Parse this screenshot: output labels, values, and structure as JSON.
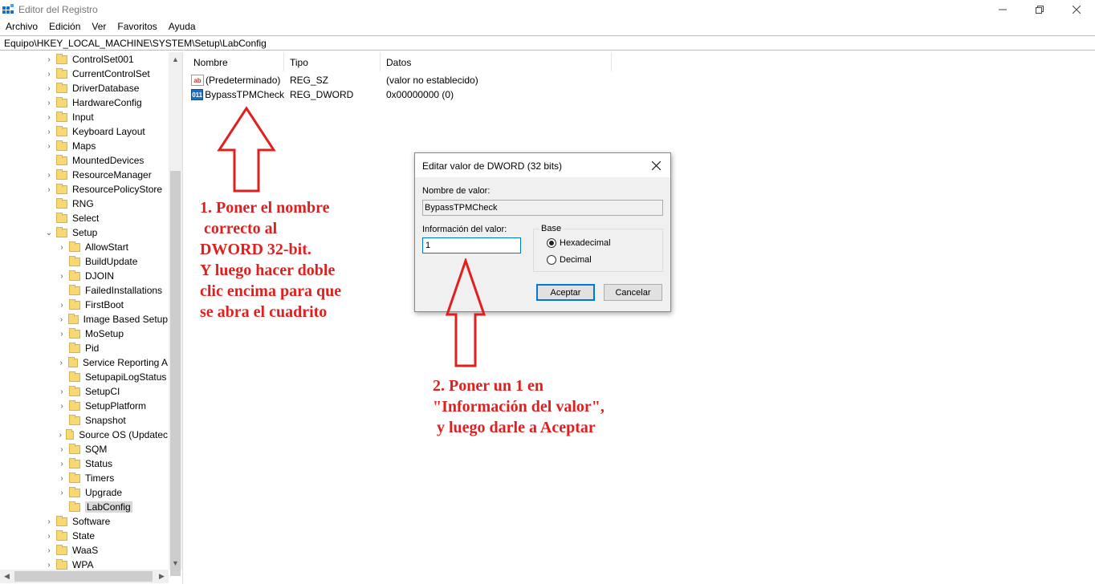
{
  "window": {
    "title": "Editor del Registro"
  },
  "menu": [
    "Archivo",
    "Edición",
    "Ver",
    "Favoritos",
    "Ayuda"
  ],
  "address": "Equipo\\HKEY_LOCAL_MACHINE\\SYSTEM\\Setup\\LabConfig",
  "tree": {
    "items": [
      {
        "label": "ControlSet001",
        "level": 0,
        "chevron": "›"
      },
      {
        "label": "CurrentControlSet",
        "level": 0,
        "chevron": "›"
      },
      {
        "label": "DriverDatabase",
        "level": 0,
        "chevron": "›"
      },
      {
        "label": "HardwareConfig",
        "level": 0,
        "chevron": "›"
      },
      {
        "label": "Input",
        "level": 0,
        "chevron": "›"
      },
      {
        "label": "Keyboard Layout",
        "level": 0,
        "chevron": "›"
      },
      {
        "label": "Maps",
        "level": 0,
        "chevron": "›"
      },
      {
        "label": "MountedDevices",
        "level": 0,
        "chevron": ""
      },
      {
        "label": "ResourceManager",
        "level": 0,
        "chevron": "›"
      },
      {
        "label": "ResourcePolicyStore",
        "level": 0,
        "chevron": "›"
      },
      {
        "label": "RNG",
        "level": 0,
        "chevron": ""
      },
      {
        "label": "Select",
        "level": 0,
        "chevron": ""
      },
      {
        "label": "Setup",
        "level": 0,
        "chevron": "⌄"
      },
      {
        "label": "AllowStart",
        "level": 1,
        "chevron": "›"
      },
      {
        "label": "BuildUpdate",
        "level": 1,
        "chevron": ""
      },
      {
        "label": "DJOIN",
        "level": 1,
        "chevron": "›"
      },
      {
        "label": "FailedInstallations",
        "level": 1,
        "chevron": ""
      },
      {
        "label": "FirstBoot",
        "level": 1,
        "chevron": "›"
      },
      {
        "label": "Image Based Setup",
        "level": 1,
        "chevron": "›"
      },
      {
        "label": "MoSetup",
        "level": 1,
        "chevron": "›"
      },
      {
        "label": "Pid",
        "level": 1,
        "chevron": ""
      },
      {
        "label": "Service Reporting A",
        "level": 1,
        "chevron": "›"
      },
      {
        "label": "SetupapiLogStatus",
        "level": 1,
        "chevron": ""
      },
      {
        "label": "SetupCI",
        "level": 1,
        "chevron": "›"
      },
      {
        "label": "SetupPlatform",
        "level": 1,
        "chevron": "›"
      },
      {
        "label": "Snapshot",
        "level": 1,
        "chevron": ""
      },
      {
        "label": "Source OS (Updatec",
        "level": 1,
        "chevron": "›"
      },
      {
        "label": "SQM",
        "level": 1,
        "chevron": "›"
      },
      {
        "label": "Status",
        "level": 1,
        "chevron": "›"
      },
      {
        "label": "Timers",
        "level": 1,
        "chevron": "›"
      },
      {
        "label": "Upgrade",
        "level": 1,
        "chevron": "›"
      },
      {
        "label": "LabConfig",
        "level": 1,
        "chevron": "",
        "selected": true
      },
      {
        "label": "Software",
        "level": 0,
        "chevron": "›"
      },
      {
        "label": "State",
        "level": 0,
        "chevron": "›"
      },
      {
        "label": "WaaS",
        "level": 0,
        "chevron": "›"
      },
      {
        "label": "WPA",
        "level": 0,
        "chevron": "›"
      }
    ]
  },
  "list": {
    "columns": [
      "Nombre",
      "Tipo",
      "Datos"
    ],
    "rows": [
      {
        "icon": "ab",
        "icon_name": "string-value-icon",
        "name": "(Predeterminado)",
        "type": "REG_SZ",
        "data": "(valor no establecido)"
      },
      {
        "icon": "011",
        "icon_name": "dword-value-icon",
        "name": "BypassTPMCheck",
        "type": "REG_DWORD",
        "data": "0x00000000 (0)"
      }
    ]
  },
  "dialog": {
    "title": "Editar valor de DWORD (32 bits)",
    "name_label": "Nombre de valor:",
    "name_value": "BypassTPMCheck",
    "data_label": "Información del valor:",
    "data_value": "1",
    "base_label": "Base",
    "radio_hex": "Hexadecimal",
    "radio_dec": "Decimal",
    "selected_base": "Hexadecimal",
    "ok_label": "Aceptar",
    "cancel_label": "Cancelar"
  },
  "annotations": {
    "step1": "1. Poner el nombre\n correcto al\nDWORD 32-bit.\nY luego hacer doble\nclic encima para que\nse abra el cuadrito",
    "step2": "2. Poner un 1 en\n\"Información del valor\",\n y luego darle a Aceptar",
    "color": "#e0201f"
  },
  "colors": {
    "accent": "#0078d7",
    "folder": "#f8d775"
  }
}
